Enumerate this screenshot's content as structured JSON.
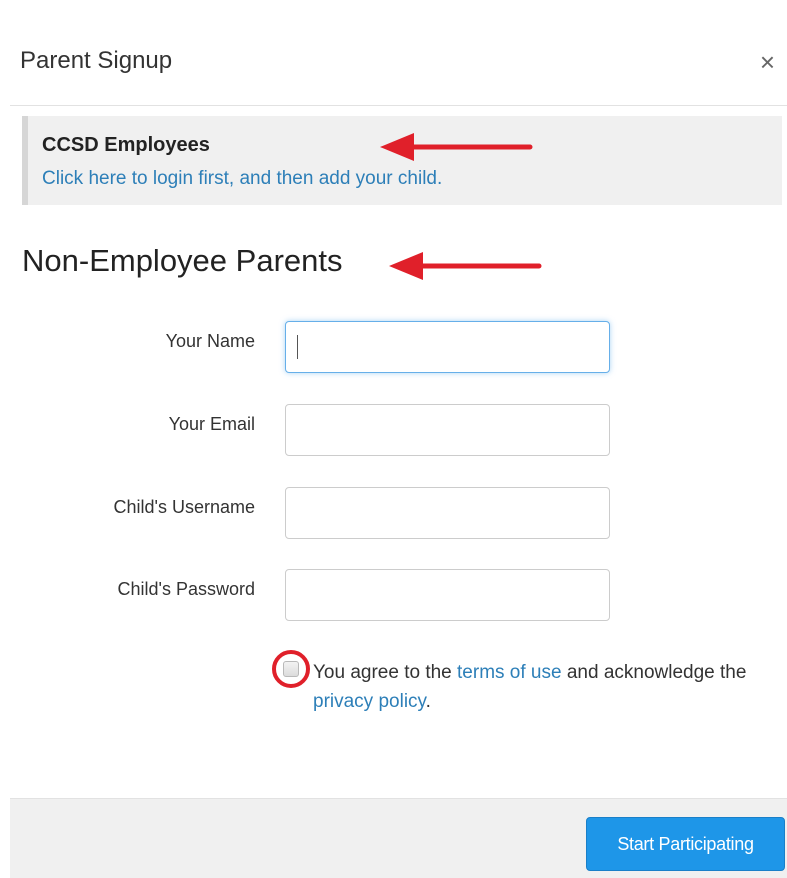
{
  "modal": {
    "title": "Parent Signup",
    "close_label": "×"
  },
  "employees": {
    "heading": "CCSD Employees",
    "link_text": "Click here to login first, and then add your child."
  },
  "non_employees": {
    "heading": "Non-Employee Parents"
  },
  "form": {
    "fields": [
      {
        "label": "Your Name",
        "value": "",
        "focused": true
      },
      {
        "label": "Your Email",
        "value": ""
      },
      {
        "label": "Child's Username",
        "value": ""
      },
      {
        "label": "Child's Password",
        "value": ""
      }
    ]
  },
  "agreement": {
    "checked": false,
    "prefix": "You agree to the ",
    "terms_link": "terms of use",
    "middle": " and acknowledge the ",
    "privacy_link": "privacy policy",
    "suffix": "."
  },
  "footer": {
    "submit_label": "Start Participating"
  },
  "colors": {
    "link": "#2d7fb8",
    "button": "#1e96e8",
    "annotation": "#e0202a"
  }
}
